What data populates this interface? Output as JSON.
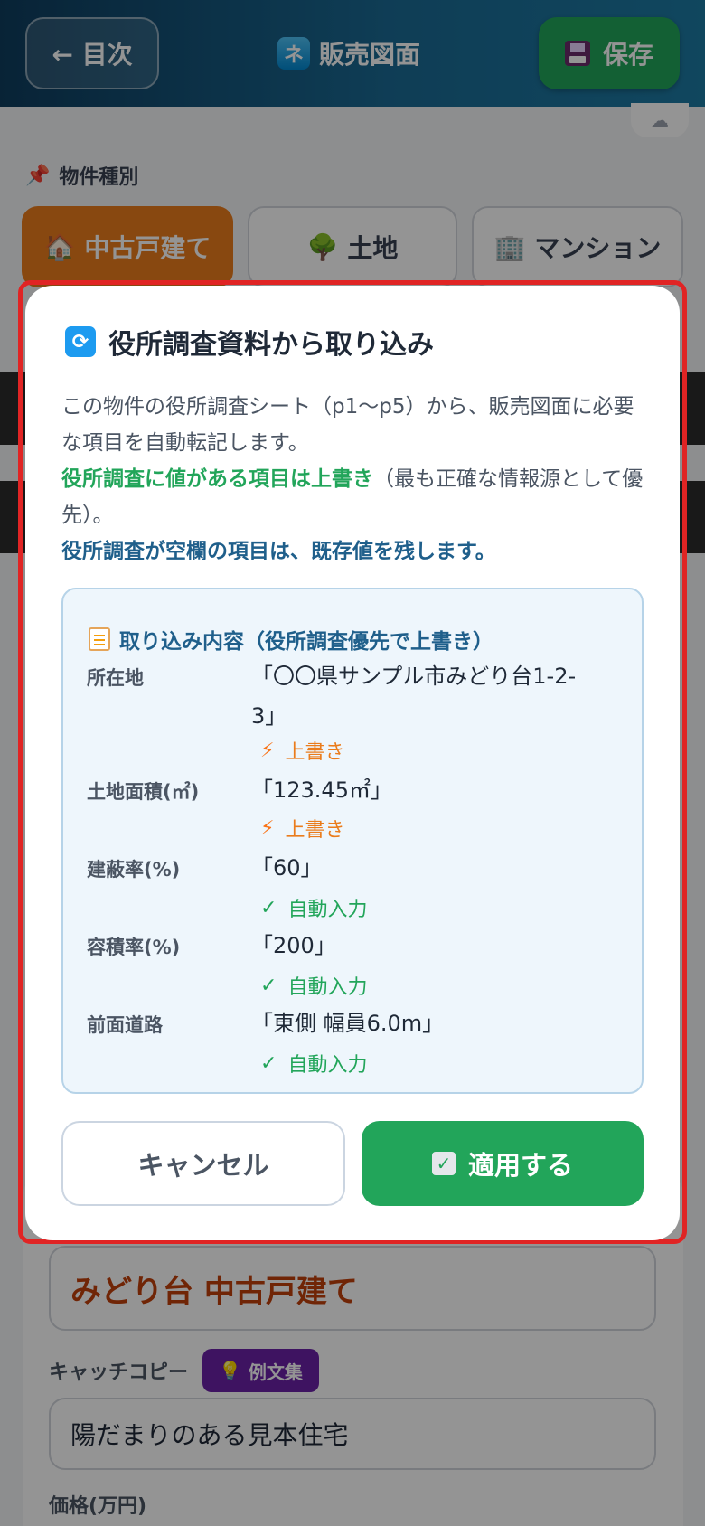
{
  "header": {
    "back_label": "← 目次",
    "app_icon_char": "ネ",
    "title": "販売図面",
    "save_label": "保存"
  },
  "cloud_icon": "cloud-icon",
  "property_type": {
    "section_label": "物件種別",
    "tabs": [
      {
        "label": "中古戸建て",
        "icon": "house-icon",
        "icon_char": "🏠",
        "active": true
      },
      {
        "label": "土地",
        "icon": "tree-icon",
        "icon_char": "🌳",
        "active": false
      },
      {
        "label": "マンション",
        "icon": "building-icon",
        "icon_char": "🏢",
        "active": false
      }
    ]
  },
  "background_form": {
    "property_title": "みどり台 中古戸建て",
    "catch_copy_label": "キャッチコピー",
    "examples_chip": "例文集",
    "catch_copy_value": "陽だまりのある見本住宅",
    "price_label": "価格(万円)"
  },
  "modal": {
    "title": "役所調査資料から取り込み",
    "desc_line1": "この物件の役所調査シート（p1〜p5）から、販売図面に必要な項目を自動転記します。",
    "desc_green": "役所調査に値がある項目は上書き",
    "desc_green_suffix": "（最も正確な情報源として優先）。",
    "desc_blue": "役所調査が空欄の項目は、既存値を残します。",
    "import_heading": "取り込み内容（役所調査優先で上書き）",
    "rows": [
      {
        "label": "所在地",
        "value": "「〇〇県サンプル市みどり台1-2-3」",
        "status": "上書き",
        "kind": "over"
      },
      {
        "label": "土地面積(㎡)",
        "value": "「123.45㎡」",
        "status": "上書き",
        "kind": "over"
      },
      {
        "label": "建蔽率(%)",
        "value": "「60」",
        "status": "自動入力",
        "kind": "auto"
      },
      {
        "label": "容積率(%)",
        "value": "「200」",
        "status": "自動入力",
        "kind": "auto"
      },
      {
        "label": "前面道路",
        "value": "「東側 幅員6.0m」",
        "status": "自動入力",
        "kind": "auto"
      }
    ],
    "cancel_label": "キャンセル",
    "apply_label": "適用する"
  },
  "colors": {
    "accent_green": "#22a55a",
    "accent_orange": "#ea7c1c",
    "heading_blue": "#1f5f8b",
    "highlight_red": "#e02424"
  }
}
